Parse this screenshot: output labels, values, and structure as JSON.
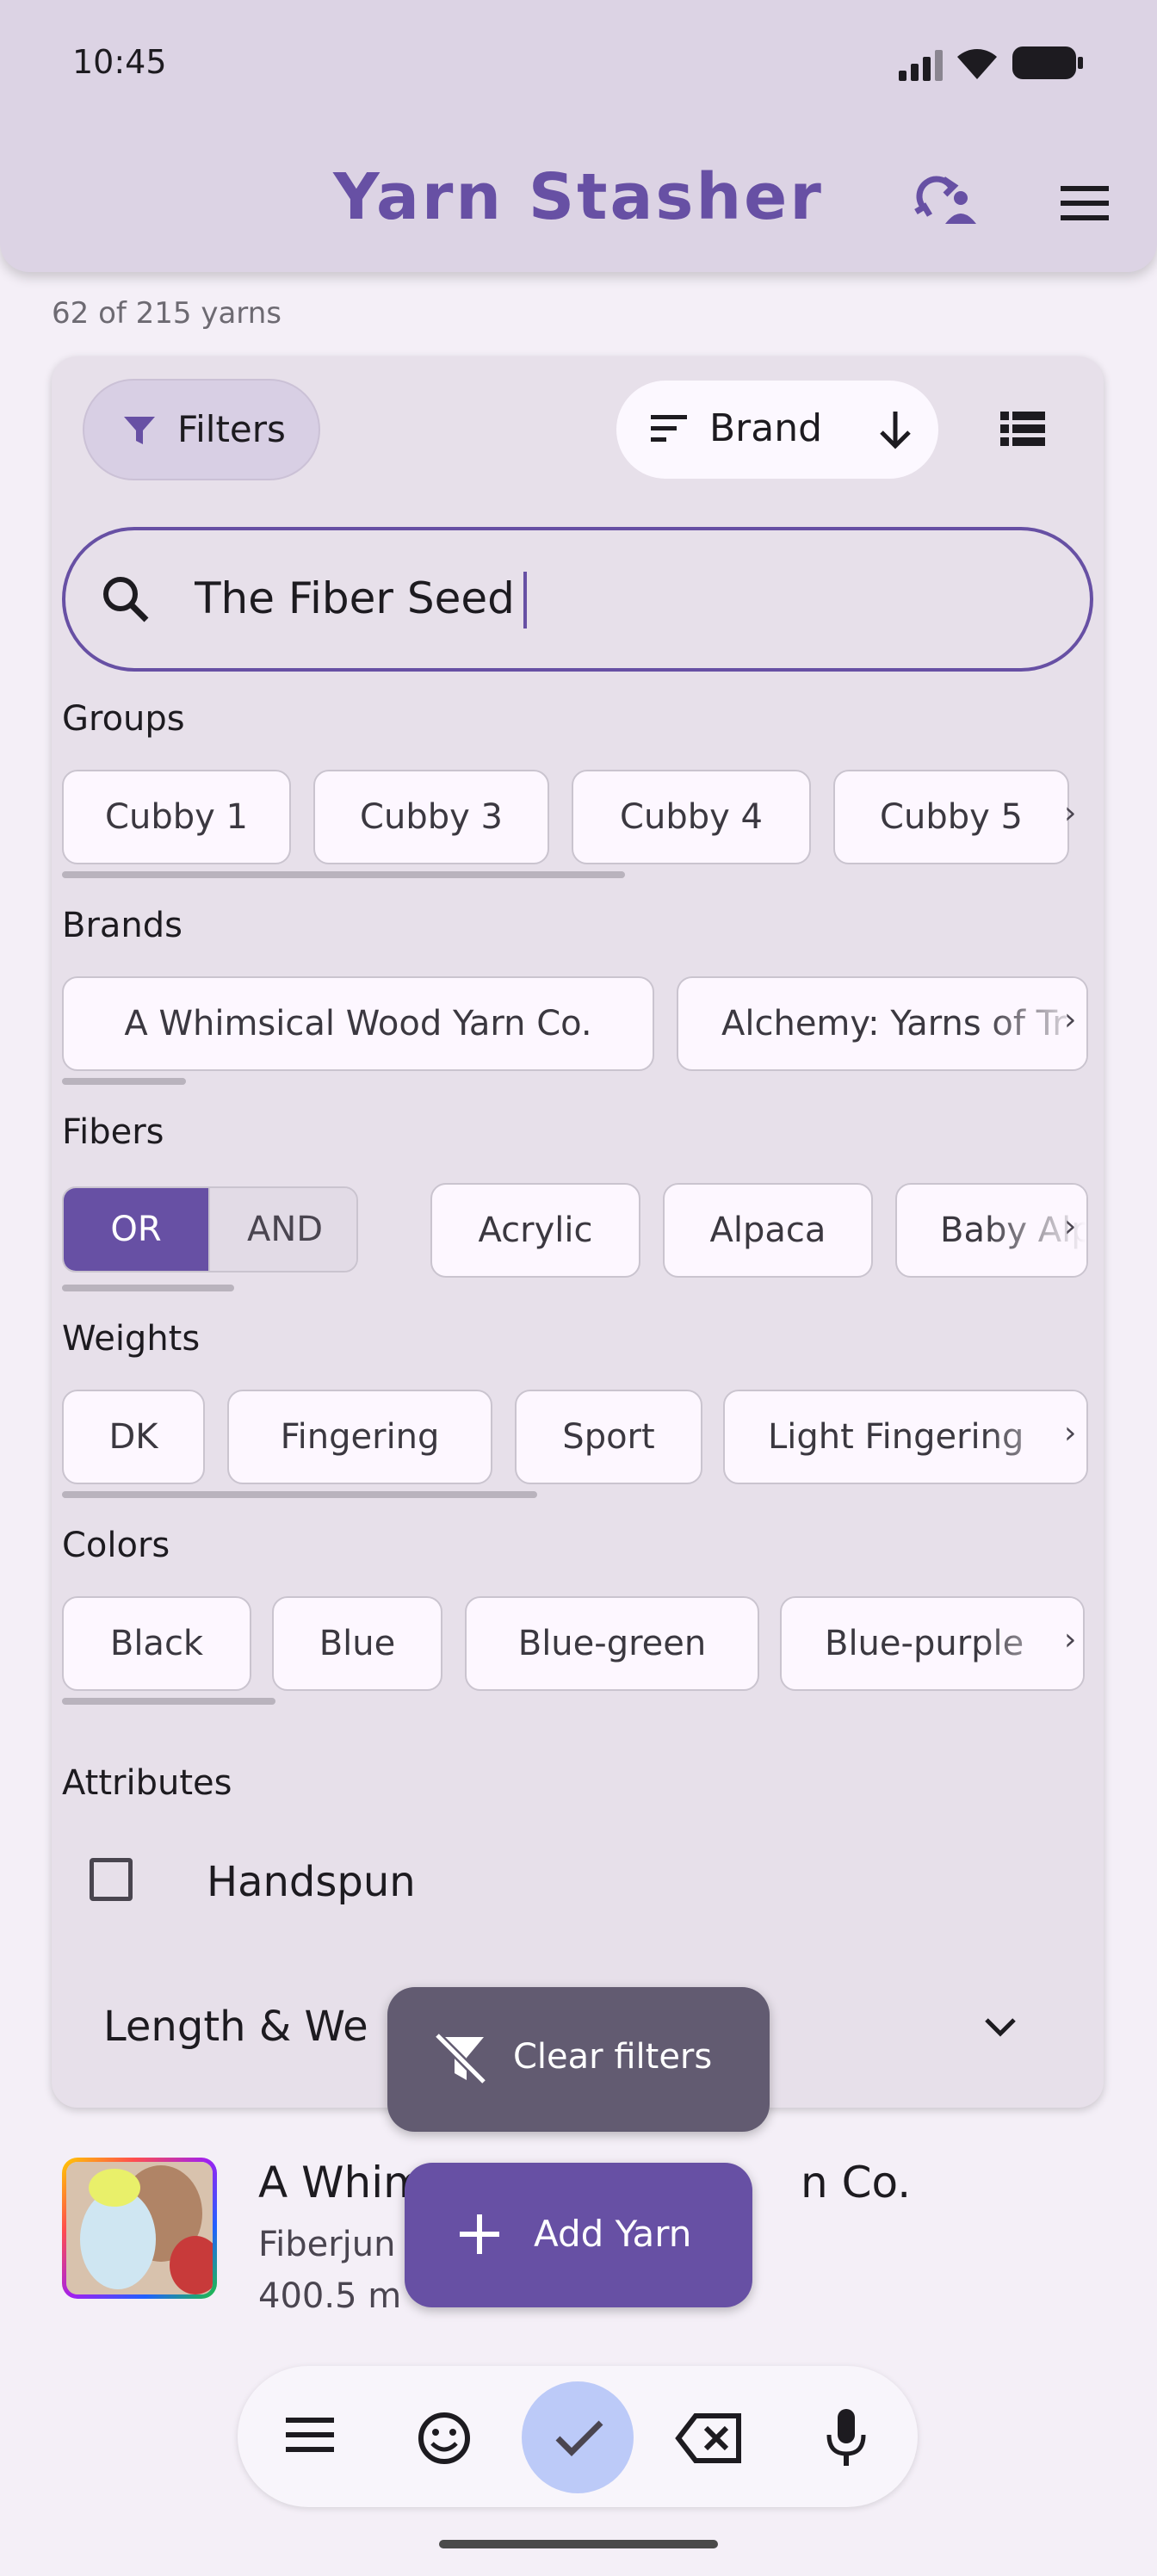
{
  "status_bar": {
    "time": "10:45"
  },
  "app_bar": {
    "title": "Yarn Stasher"
  },
  "yarn_count": "62 of 215 yarns",
  "toolbar": {
    "filters_label": "Filters",
    "sort_label": "Brand"
  },
  "search": {
    "value": "The Fiber Seed"
  },
  "groups": {
    "title": "Groups",
    "chips": [
      "Cubby 1",
      "Cubby 3",
      "Cubby 4",
      "Cubby 5"
    ]
  },
  "brands": {
    "title": "Brands",
    "chips": [
      "A Whimsical Wood Yarn Co.",
      "Alchemy: Yarns of Tr"
    ]
  },
  "fibers": {
    "title": "Fibers",
    "toggle": {
      "or": "OR",
      "and": "AND",
      "selected": "OR"
    },
    "chips": [
      "Acrylic",
      "Alpaca",
      "Baby Alp"
    ]
  },
  "weights": {
    "title": "Weights",
    "chips": [
      "DK",
      "Fingering",
      "Sport",
      "Light Fingering"
    ]
  },
  "colors": {
    "title": "Colors",
    "chips": [
      "Black",
      "Blue",
      "Blue-green",
      "Blue-purple"
    ]
  },
  "attributes": {
    "title": "Attributes",
    "handspun_label": "Handspun",
    "handspun_checked": false
  },
  "length_weight": {
    "label": "Length & We"
  },
  "fab": {
    "clear_label": "Clear filters",
    "add_label": "Add Yarn"
  },
  "yarn_item": {
    "name": "A Whim",
    "name_tail": "n Co.",
    "line1": "Fiberjun",
    "line2": "400.5 m"
  },
  "colors_theme": {
    "primary": "#6750a4",
    "app_bar": "#dcd3e4",
    "card": "#e7e0ea",
    "fab_secondary": "#625b71"
  },
  "keyboard_toolbar": {
    "icons": [
      "menu-icon",
      "emoji-icon",
      "check-icon",
      "backspace-icon",
      "mic-icon"
    ]
  }
}
